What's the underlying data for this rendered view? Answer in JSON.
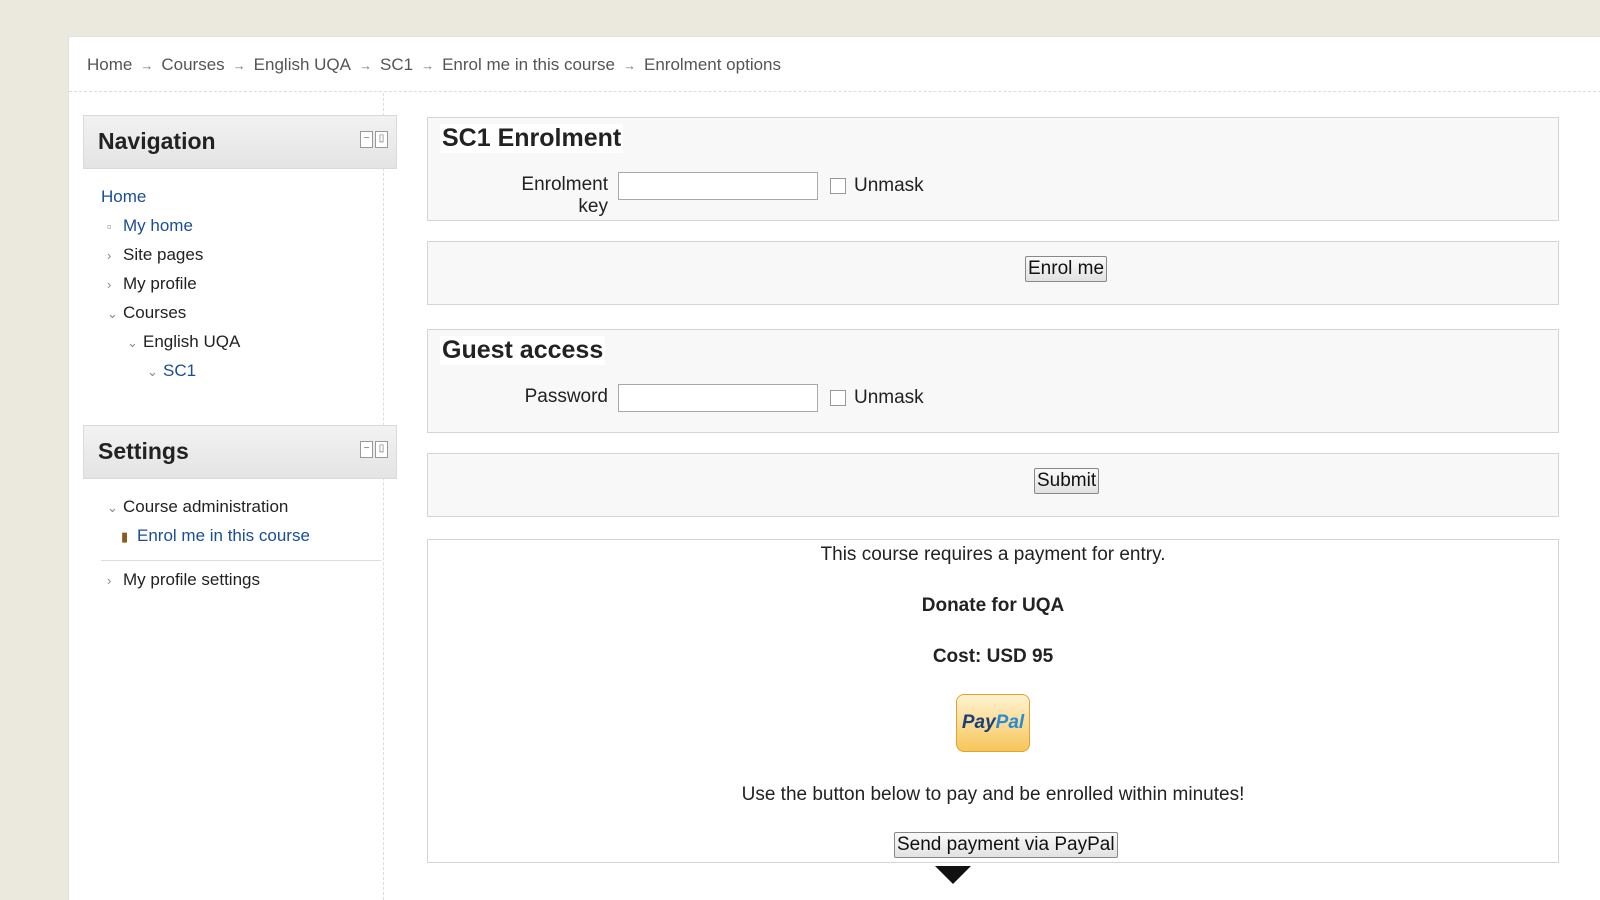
{
  "breadcrumb": [
    "Home",
    "Courses",
    "English UQA",
    "SC1",
    "Enrol me in this course",
    "Enrolment options"
  ],
  "breadcrumb_separator": "→",
  "navigation": {
    "title": "Navigation",
    "items": [
      {
        "label": "Home",
        "icon": "none"
      },
      {
        "label": "My home",
        "icon": "square-bullet"
      },
      {
        "label": "Site pages",
        "icon": "chevron-right"
      },
      {
        "label": "My profile",
        "icon": "chevron-right"
      },
      {
        "label": "Courses",
        "icon": "chevron-down"
      },
      {
        "label": "English UQA",
        "icon": "chevron-down"
      },
      {
        "label": "SC1",
        "icon": "chevron-down"
      }
    ]
  },
  "settings": {
    "title": "Settings",
    "items": [
      {
        "label": "Course administration",
        "icon": "chevron-down"
      },
      {
        "label": "Enrol me in this course",
        "icon": "door-icon"
      },
      {
        "label": "My profile settings",
        "icon": "chevron-right"
      }
    ]
  },
  "enrolment": {
    "legend": "SC1 Enrolment",
    "key_label": "Enrolment key",
    "key_value": "",
    "unmask_label": "Unmask",
    "submit_label": "Enrol me"
  },
  "guest": {
    "legend": "Guest access",
    "password_label": "Password",
    "password_value": "",
    "unmask_label": "Unmask",
    "submit_label": "Submit"
  },
  "payment": {
    "requires_text": "This course requires a payment for entry.",
    "donate_text": "Donate for UQA",
    "cost_text": "Cost: USD 95",
    "paypal_logo": {
      "part1": "Pay",
      "part2": "Pal"
    },
    "instruction_text": "Use the button below to pay and be enrolled within minutes!",
    "pay_button_label": "Send payment via PayPal"
  }
}
